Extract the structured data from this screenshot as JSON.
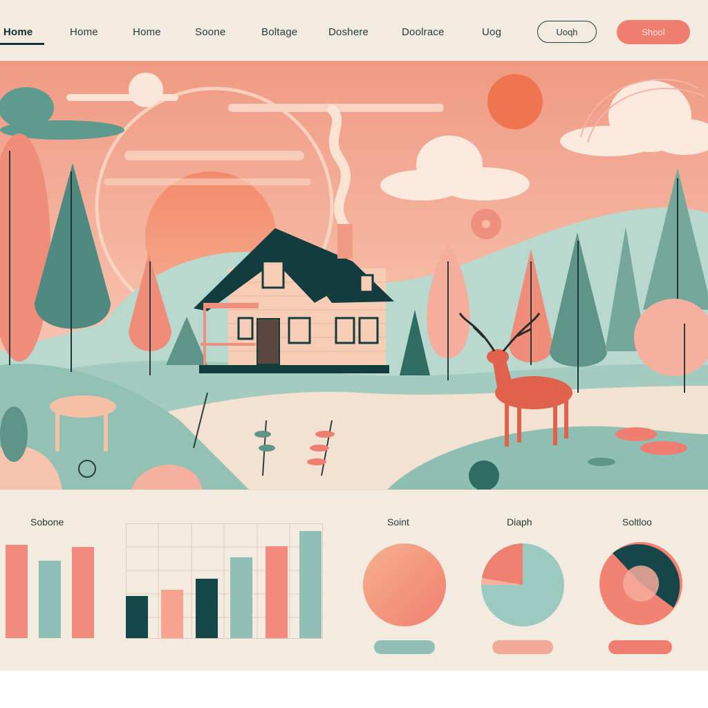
{
  "nav": {
    "items": [
      {
        "label": "Home",
        "active": true
      },
      {
        "label": "Home",
        "active": false
      },
      {
        "label": "Home",
        "active": false
      },
      {
        "label": "Soone",
        "active": false
      },
      {
        "label": "Boltage",
        "active": false
      },
      {
        "label": "Doshere",
        "active": false
      },
      {
        "label": "Doolrace",
        "active": false
      },
      {
        "label": "Uog",
        "active": false
      }
    ],
    "outline_button": "Uoqh",
    "solid_button": "Shool"
  },
  "hero": {
    "scene": "forest-cabin-illustration",
    "colors": {
      "sky": "#f3a990",
      "hill": "#a9cfc5",
      "tree_teal": "#5f9588",
      "tree_coral": "#ef8f7e",
      "house_roof": "#123c3d",
      "deer": "#e0624d"
    }
  },
  "dashboard": {
    "bar_chart_left": {
      "title": "Sobone",
      "colors": [
        "#f28b7e",
        "#8fbfb6",
        "#f28b7e"
      ],
      "values": [
        0.98,
        0.81,
        0.96
      ]
    },
    "bar_chart_grid": {
      "colors": [
        "#134749",
        "#f7a38f",
        "#134749",
        "#8fbfb6",
        "#f28b7e",
        "#8fbfb6"
      ],
      "values": [
        0.38,
        0.44,
        0.54,
        0.73,
        0.83,
        0.97
      ]
    },
    "pies": [
      {
        "title": "Soint",
        "pill_label": "",
        "pill_color": "#8fbfb6",
        "type": "solid"
      },
      {
        "title": "Diaph",
        "pill_label": "",
        "pill_color": "#f4aa98",
        "type": "pie"
      },
      {
        "title": "Soltloo",
        "pill_label": "",
        "pill_color": "#ef7d70",
        "type": "donut"
      }
    ]
  }
}
